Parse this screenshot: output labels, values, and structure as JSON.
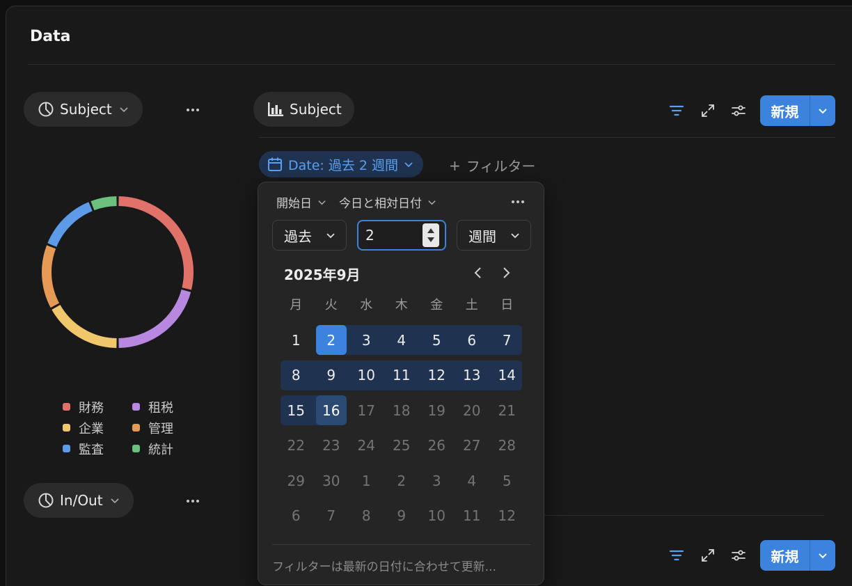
{
  "page": {
    "title": "Data"
  },
  "left": {
    "chart1": {
      "label": "Subject"
    },
    "chart2": {
      "label": "In/Out"
    },
    "legend": [
      {
        "label": "財務",
        "color": "#e0726a"
      },
      {
        "label": "租税",
        "color": "#b888e0"
      },
      {
        "label": "企業",
        "color": "#f0c76a"
      },
      {
        "label": "管理",
        "color": "#e59a56"
      },
      {
        "label": "監査",
        "color": "#5d9be8"
      },
      {
        "label": "統計",
        "color": "#6cc07e"
      }
    ]
  },
  "chart_data": {
    "type": "pie",
    "categories": [
      "財務",
      "租税",
      "企業",
      "管理",
      "監査",
      "統計"
    ],
    "values": [
      29,
      21,
      17,
      14,
      13,
      6
    ],
    "colors": [
      "#e0726a",
      "#b888e0",
      "#f0c76a",
      "#e59a56",
      "#5d9be8",
      "#6cc07e"
    ],
    "title": ""
  },
  "right": {
    "view_label": "Subject",
    "new_button": "新規",
    "date_chip": "Date: 過去 2 週間",
    "add_filter": "フィルター",
    "add_filter_plus": "+"
  },
  "popup": {
    "field": "開始日",
    "mode": "今日と相対日付",
    "direction": "過去",
    "amount": "2",
    "unit": "週間",
    "month_title": "2025年9月",
    "weekdays": [
      "月",
      "火",
      "水",
      "木",
      "金",
      "土",
      "日"
    ],
    "weeks": [
      [
        "1",
        "2",
        "3",
        "4",
        "5",
        "6",
        "7"
      ],
      [
        "8",
        "9",
        "10",
        "11",
        "12",
        "13",
        "14"
      ],
      [
        "15",
        "16",
        "17",
        "18",
        "19",
        "20",
        "21"
      ],
      [
        "22",
        "23",
        "24",
        "25",
        "26",
        "27",
        "28"
      ],
      [
        "29",
        "30",
        "1",
        "2",
        "3",
        "4",
        "5"
      ],
      [
        "6",
        "7",
        "8",
        "9",
        "10",
        "11",
        "12"
      ]
    ],
    "range_start": "2",
    "range_end": "16",
    "footer": "フィルターは最新の日付に合わせて更新..."
  },
  "colors": {
    "accent": "#3b83dd",
    "range": "#1f3350"
  }
}
